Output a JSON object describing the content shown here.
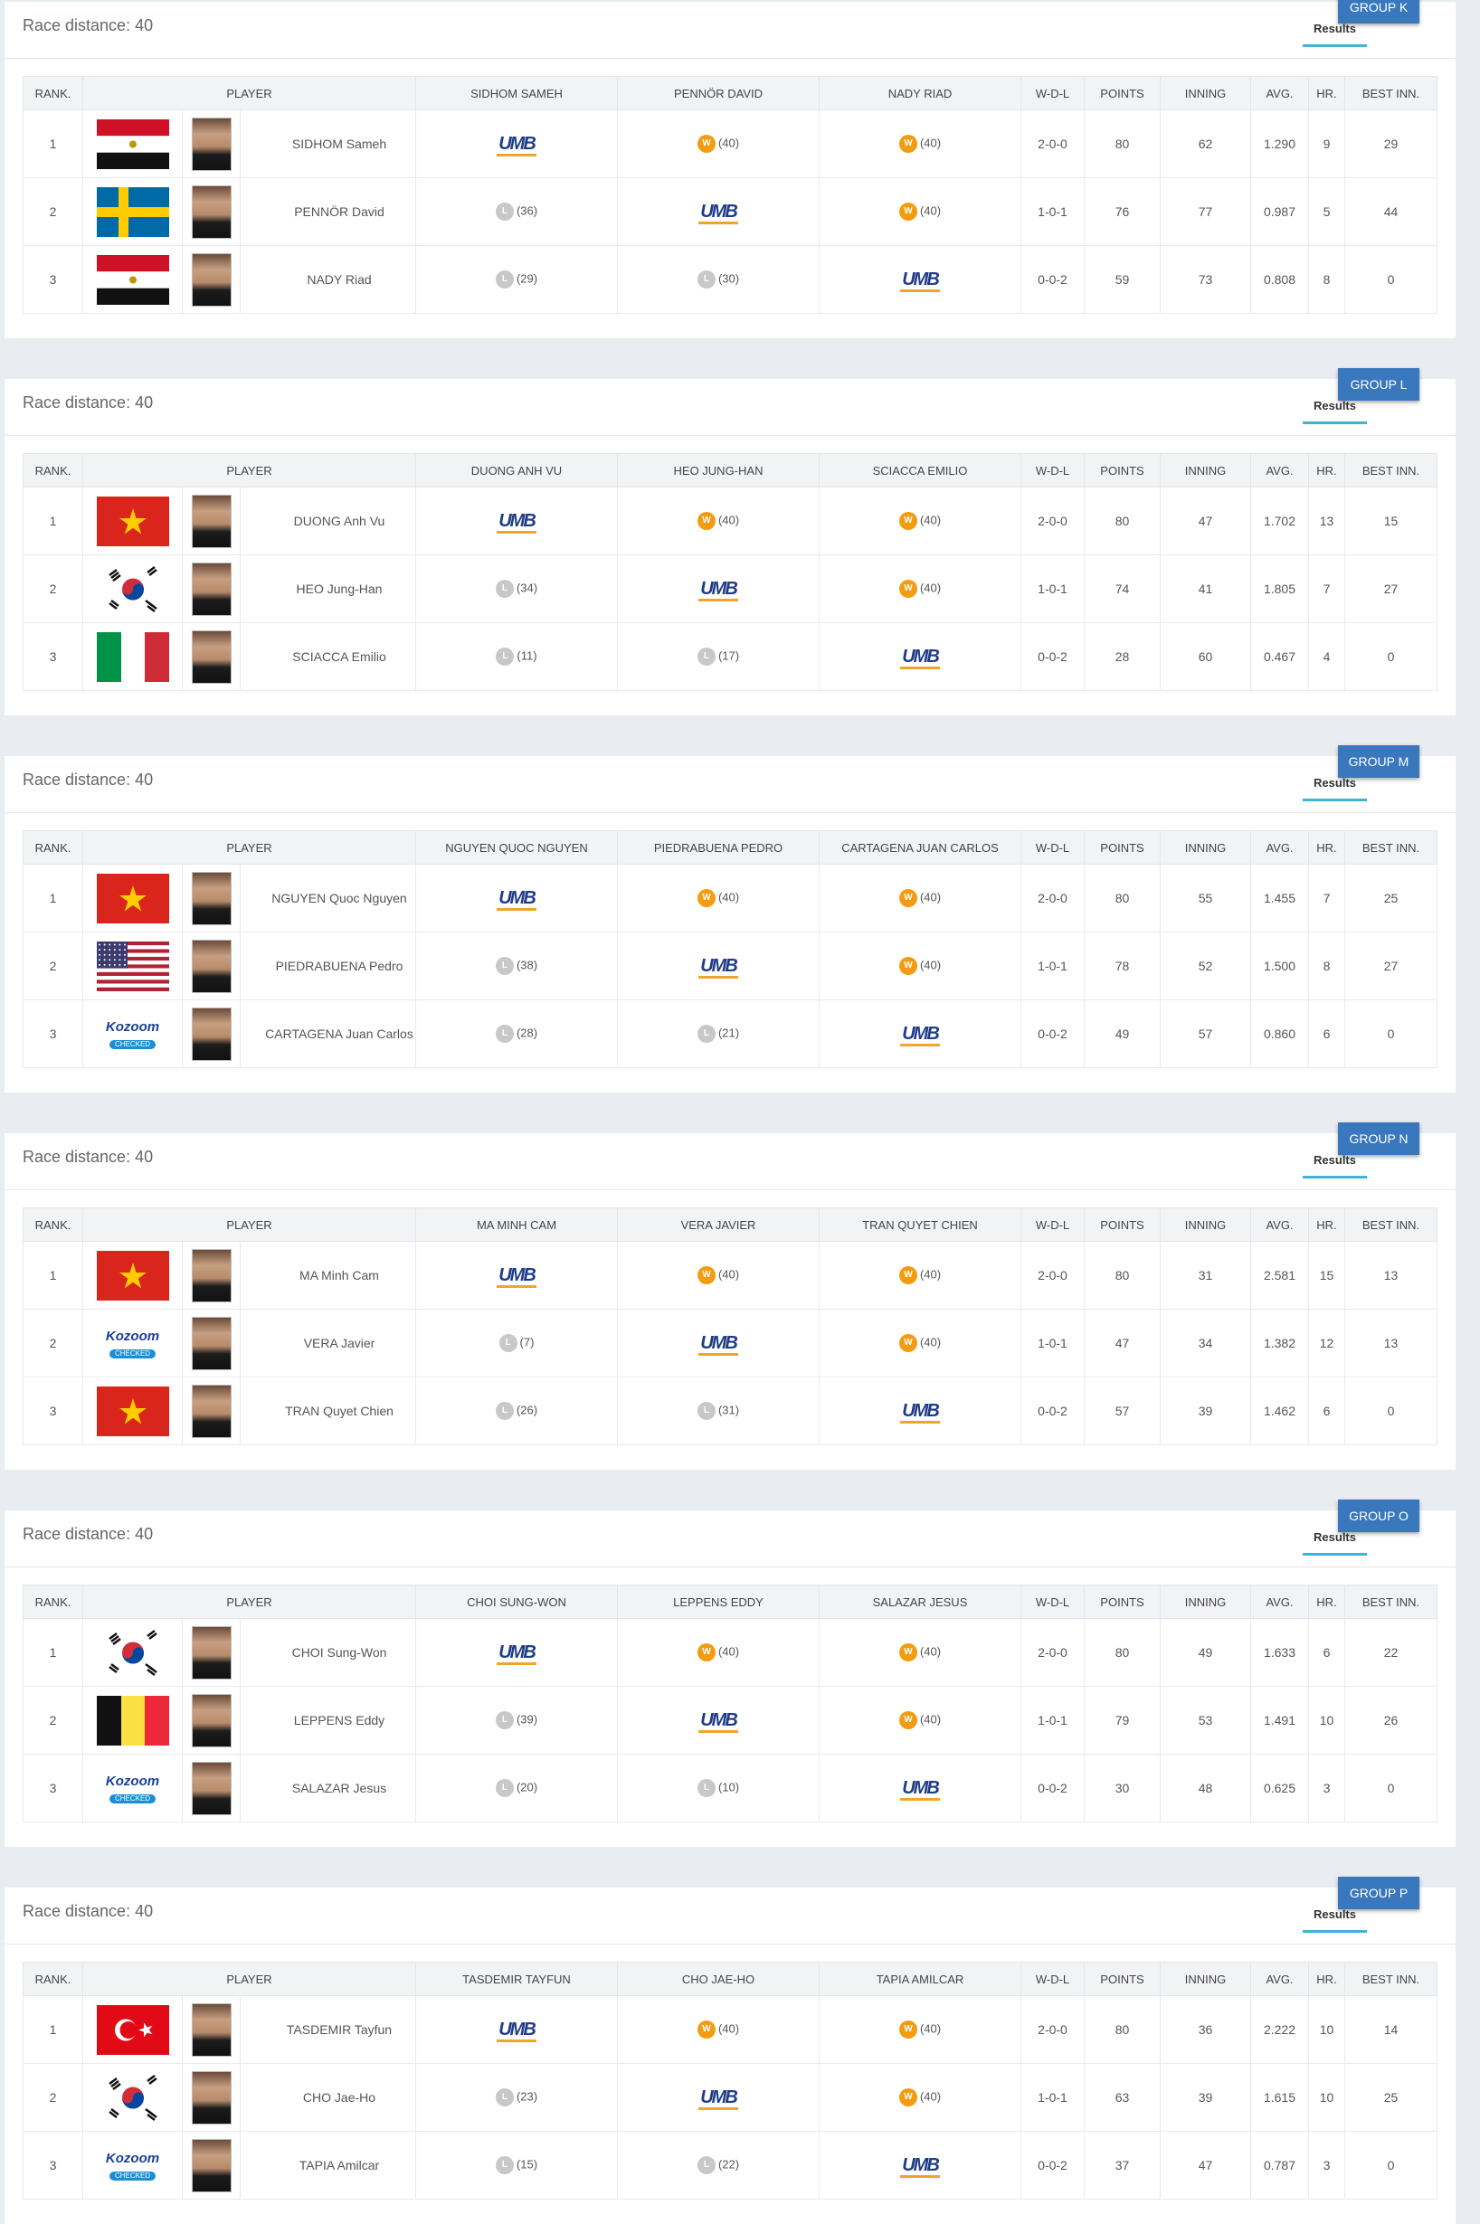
{
  "race_label": "Race distance: 40",
  "results_label": "Results",
  "columns": {
    "rank": "RANK.",
    "player": "PLAYER",
    "wdl": "W-D-L",
    "points": "POINTS",
    "inning": "INNING",
    "avg": "AVG.",
    "hr": "HR.",
    "best": "BEST INN."
  },
  "groups": [
    {
      "name": "GROUP K",
      "opponents": [
        "SIDHOM SAMEH",
        "PENNÖR DAVID",
        "NADY RIAD"
      ],
      "rows": [
        {
          "rank": "1",
          "flag": "egypt",
          "player": "SIDHOM Sameh",
          "results": [
            "umb",
            "w:(40)",
            "w:(40)"
          ],
          "wdl": "2-0-0",
          "points": "80",
          "inning": "62",
          "avg": "1.290",
          "hr": "9",
          "best": "29"
        },
        {
          "rank": "2",
          "flag": "sweden",
          "player": "PENNÖR David",
          "results": [
            "l:(36)",
            "umb",
            "w:(40)"
          ],
          "wdl": "1-0-1",
          "points": "76",
          "inning": "77",
          "avg": "0.987",
          "hr": "5",
          "best": "44"
        },
        {
          "rank": "3",
          "flag": "egypt",
          "player": "NADY Riad",
          "results": [
            "l:(29)",
            "l:(30)",
            "umb"
          ],
          "wdl": "0-0-2",
          "points": "59",
          "inning": "73",
          "avg": "0.808",
          "hr": "8",
          "best": "0"
        }
      ]
    },
    {
      "name": "GROUP L",
      "opponents": [
        "DUONG ANH VU",
        "HEO JUNG-HAN",
        "SCIACCA EMILIO"
      ],
      "rows": [
        {
          "rank": "1",
          "flag": "vietnam",
          "player": "DUONG Anh Vu",
          "results": [
            "umb",
            "w:(40)",
            "w:(40)"
          ],
          "wdl": "2-0-0",
          "points": "80",
          "inning": "47",
          "avg": "1.702",
          "hr": "13",
          "best": "15"
        },
        {
          "rank": "2",
          "flag": "korea",
          "player": "HEO Jung-Han",
          "results": [
            "l:(34)",
            "umb",
            "w:(40)"
          ],
          "wdl": "1-0-1",
          "points": "74",
          "inning": "41",
          "avg": "1.805",
          "hr": "7",
          "best": "27"
        },
        {
          "rank": "3",
          "flag": "italy",
          "player": "SCIACCA Emilio",
          "results": [
            "l:(11)",
            "l:(17)",
            "umb"
          ],
          "wdl": "0-0-2",
          "points": "28",
          "inning": "60",
          "avg": "0.467",
          "hr": "4",
          "best": "0"
        }
      ]
    },
    {
      "name": "GROUP M",
      "opponents": [
        "NGUYEN QUOC NGUYEN",
        "PIEDRABUENA PEDRO",
        "CARTAGENA JUAN CARLOS"
      ],
      "rows": [
        {
          "rank": "1",
          "flag": "vietnam",
          "player": "NGUYEN Quoc Nguyen",
          "results": [
            "umb",
            "w:(40)",
            "w:(40)"
          ],
          "wdl": "2-0-0",
          "points": "80",
          "inning": "55",
          "avg": "1.455",
          "hr": "7",
          "best": "25"
        },
        {
          "rank": "2",
          "flag": "usa",
          "player": "PIEDRABUENA Pedro",
          "results": [
            "l:(38)",
            "umb",
            "w:(40)"
          ],
          "wdl": "1-0-1",
          "points": "78",
          "inning": "52",
          "avg": "1.500",
          "hr": "8",
          "best": "27"
        },
        {
          "rank": "3",
          "flag": "kozoom",
          "player": "CARTAGENA Juan Carlos",
          "results": [
            "l:(28)",
            "l:(21)",
            "umb"
          ],
          "wdl": "0-0-2",
          "points": "49",
          "inning": "57",
          "avg": "0.860",
          "hr": "6",
          "best": "0"
        }
      ]
    },
    {
      "name": "GROUP N",
      "opponents": [
        "MA MINH CAM",
        "VERA JAVIER",
        "TRAN QUYET CHIEN"
      ],
      "rows": [
        {
          "rank": "1",
          "flag": "vietnam",
          "player": "MA Minh Cam",
          "results": [
            "umb",
            "w:(40)",
            "w:(40)"
          ],
          "wdl": "2-0-0",
          "points": "80",
          "inning": "31",
          "avg": "2.581",
          "hr": "15",
          "best": "13"
        },
        {
          "rank": "2",
          "flag": "kozoom",
          "player": "VERA Javier",
          "results": [
            "l:(7)",
            "umb",
            "w:(40)"
          ],
          "wdl": "1-0-1",
          "points": "47",
          "inning": "34",
          "avg": "1.382",
          "hr": "12",
          "best": "13"
        },
        {
          "rank": "3",
          "flag": "vietnam",
          "player": "TRAN Quyet Chien",
          "results": [
            "l:(26)",
            "l:(31)",
            "umb"
          ],
          "wdl": "0-0-2",
          "points": "57",
          "inning": "39",
          "avg": "1.462",
          "hr": "6",
          "best": "0"
        }
      ]
    },
    {
      "name": "GROUP O",
      "opponents": [
        "CHOI SUNG-WON",
        "LEPPENS EDDY",
        "SALAZAR JESUS"
      ],
      "rows": [
        {
          "rank": "1",
          "flag": "korea",
          "player": "CHOI Sung-Won",
          "results": [
            "umb",
            "w:(40)",
            "w:(40)"
          ],
          "wdl": "2-0-0",
          "points": "80",
          "inning": "49",
          "avg": "1.633",
          "hr": "6",
          "best": "22"
        },
        {
          "rank": "2",
          "flag": "belgium",
          "player": "LEPPENS Eddy",
          "results": [
            "l:(39)",
            "umb",
            "w:(40)"
          ],
          "wdl": "1-0-1",
          "points": "79",
          "inning": "53",
          "avg": "1.491",
          "hr": "10",
          "best": "26"
        },
        {
          "rank": "3",
          "flag": "kozoom",
          "player": "SALAZAR Jesus",
          "results": [
            "l:(20)",
            "l:(10)",
            "umb"
          ],
          "wdl": "0-0-2",
          "points": "30",
          "inning": "48",
          "avg": "0.625",
          "hr": "3",
          "best": "0"
        }
      ]
    },
    {
      "name": "GROUP P",
      "opponents": [
        "TASDEMIR TAYFUN",
        "CHO JAE-HO",
        "TAPIA AMILCAR"
      ],
      "rows": [
        {
          "rank": "1",
          "flag": "turkey",
          "player": "TASDEMIR Tayfun",
          "results": [
            "umb",
            "w:(40)",
            "w:(40)"
          ],
          "wdl": "2-0-0",
          "points": "80",
          "inning": "36",
          "avg": "2.222",
          "hr": "10",
          "best": "14"
        },
        {
          "rank": "2",
          "flag": "korea",
          "player": "CHO Jae-Ho",
          "results": [
            "l:(23)",
            "umb",
            "w:(40)"
          ],
          "wdl": "1-0-1",
          "points": "63",
          "inning": "39",
          "avg": "1.615",
          "hr": "10",
          "best": "25"
        },
        {
          "rank": "3",
          "flag": "kozoom",
          "player": "TAPIA Amilcar",
          "results": [
            "l:(15)",
            "l:(22)",
            "umb"
          ],
          "wdl": "0-0-2",
          "points": "37",
          "inning": "47",
          "avg": "0.787",
          "hr": "3",
          "best": "0"
        }
      ]
    }
  ],
  "umb_text": "UMB",
  "kozoom_text": "Kozoom",
  "kozoom_sub": "CHECKED",
  "badge_w": "W",
  "badge_l": "L"
}
